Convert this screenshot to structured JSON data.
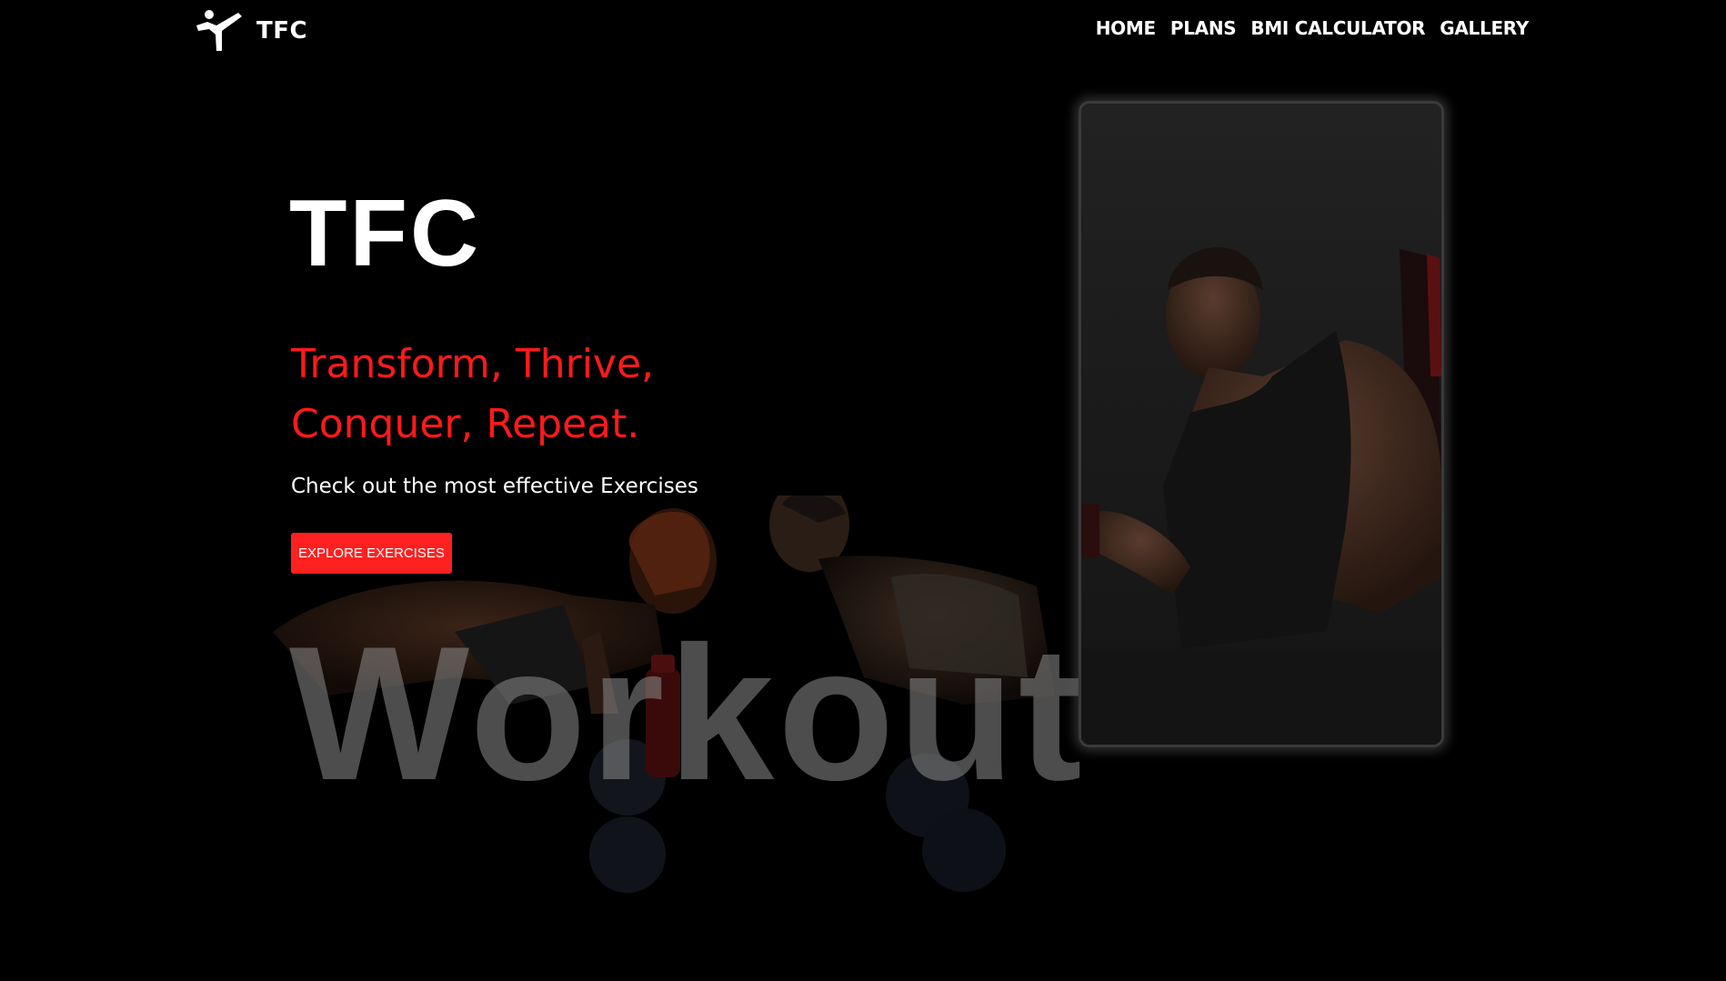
{
  "brand": {
    "name": "TFC",
    "logo_icon": "karate-kick-icon"
  },
  "nav": {
    "items": [
      {
        "label": "HOME"
      },
      {
        "label": "PLANS"
      },
      {
        "label": "BMI CALCULATOR"
      },
      {
        "label": "GALLERY"
      }
    ]
  },
  "hero": {
    "title": "TFC",
    "tagline": "Transform, Thrive, Conquer, Repeat.",
    "subtitle": "Check out the most effective Exercises",
    "cta_label": "EXPLORE EXERCISES",
    "background_word": "Workout"
  },
  "colors": {
    "background": "#000000",
    "accent": "#ff1a1a",
    "button": "#ff2020",
    "text": "#ffffff"
  }
}
